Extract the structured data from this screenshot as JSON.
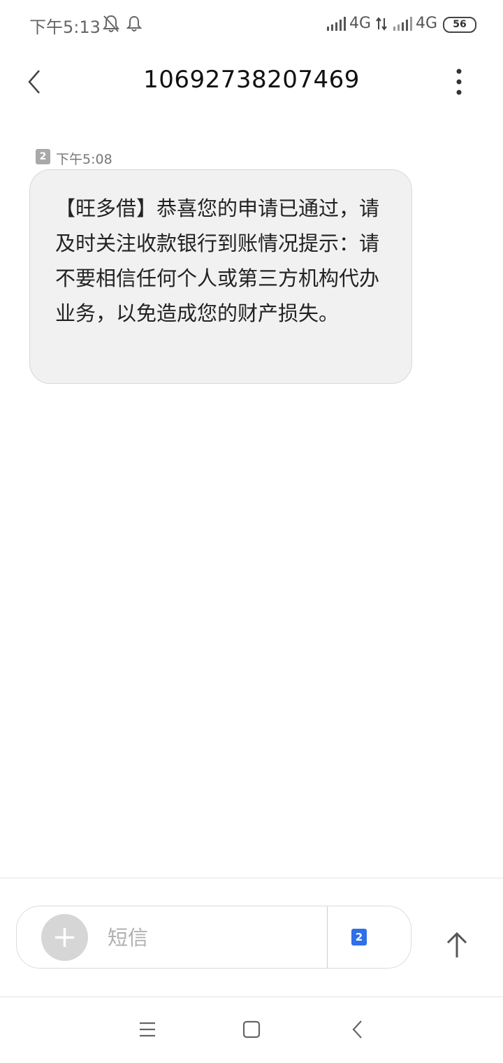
{
  "status_bar": {
    "time": "下午5:13",
    "network_1": "4G",
    "network_2": "4G",
    "battery": "56",
    "icons": [
      "mute-notification-icon",
      "alarm-bell-icon",
      "signal-bars-icon",
      "data-arrows-icon",
      "signal-bars-icon",
      "battery-icon"
    ]
  },
  "header": {
    "title": "10692738207469",
    "back_icon": "chevron-left-icon",
    "more_icon": "vertical-dots-icon"
  },
  "message": {
    "sim_badge": "2",
    "time": "下午5:08",
    "text": "【旺多借】恭喜您的申请已通过，请及时关注收款银行到账情况提示：请不要相信任何个人或第三方机构代办业务，以免造成您的财产损失。"
  },
  "composer": {
    "placeholder": "短信",
    "value": "",
    "sim_label": "2",
    "add_icon": "plus-icon",
    "send_icon": "arrow-up-icon"
  },
  "nav_bar": {
    "icons": [
      "menu-lines-icon",
      "home-square-icon",
      "back-triangle-icon"
    ]
  },
  "colors": {
    "bubble_bg": "#f1f1f1",
    "sim_select": "#2f6fe8",
    "sim_badge": "#a9a9a9"
  }
}
